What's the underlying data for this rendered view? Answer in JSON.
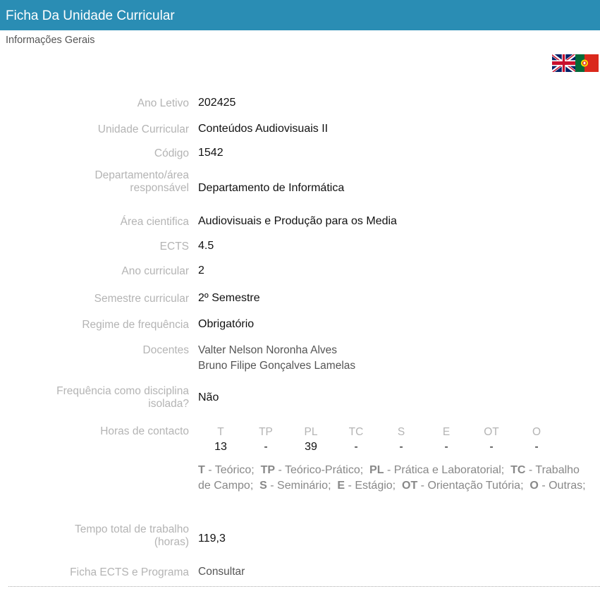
{
  "header": {
    "title": "Ficha Da Unidade Curricular"
  },
  "section": {
    "title": "Informações Gerais"
  },
  "flags": [
    {
      "icon": "uk-flag-icon",
      "lang": "English"
    },
    {
      "icon": "pt-flag-icon",
      "lang": "Português"
    }
  ],
  "fields": {
    "ano_letivo": {
      "label": "Ano Letivo",
      "value": "202425"
    },
    "unidade_curricular": {
      "label": "Unidade Curricular",
      "value": "Conteúdos Audiovisuais II"
    },
    "codigo": {
      "label": "Código",
      "value": "1542"
    },
    "departamento": {
      "label_line1": "Departamento/área",
      "label_line2": "responsável",
      "value": "Departamento de Informática"
    },
    "area_cientifica": {
      "label": "Área cientifica",
      "value": "Audiovisuais e Produção para os Media"
    },
    "ects": {
      "label": "ECTS",
      "value": "4.5"
    },
    "ano_curricular": {
      "label": "Ano curricular",
      "value": "2"
    },
    "semestre": {
      "label": "Semestre curricular",
      "value": "2º Semestre"
    },
    "regime": {
      "label": "Regime de frequência",
      "value": "Obrigatório"
    },
    "docentes": {
      "label": "Docentes",
      "values": [
        "Valter Nelson Noronha Alves",
        "Bruno Filipe Gonçalves Lamelas"
      ]
    },
    "frequencia_isolada": {
      "label_line1": "Frequência como disciplina",
      "label_line2": "isolada?",
      "value": "Não"
    },
    "tempo_total": {
      "label_line1": "Tempo total de trabalho",
      "label_line2": "(horas)",
      "value": "119,3"
    },
    "ficha_ects": {
      "label": "Ficha ECTS e Programa",
      "link": "Consultar"
    }
  },
  "horas_contacto": {
    "label": "Horas de contacto",
    "columns": [
      "T",
      "TP",
      "PL",
      "TC",
      "S",
      "E",
      "OT",
      "O"
    ],
    "values": [
      "13",
      "-",
      "39",
      "-",
      "-",
      "-",
      "-",
      "-"
    ],
    "legend": [
      {
        "abbr": "T",
        "desc": " - Teórico;"
      },
      {
        "abbr": "TP",
        "desc": " - Teórico-Prático;"
      },
      {
        "abbr": "PL",
        "desc": " - Prática e Laboratorial;"
      },
      {
        "abbr": "TC",
        "desc": " - Trabalho de Campo;"
      },
      {
        "abbr": "S",
        "desc": " - Seminário;"
      },
      {
        "abbr": "E",
        "desc": " - Estágio;"
      },
      {
        "abbr": "OT",
        "desc": " - Orientação Tutória;"
      },
      {
        "abbr": "O",
        "desc": " - Outras;"
      }
    ]
  }
}
